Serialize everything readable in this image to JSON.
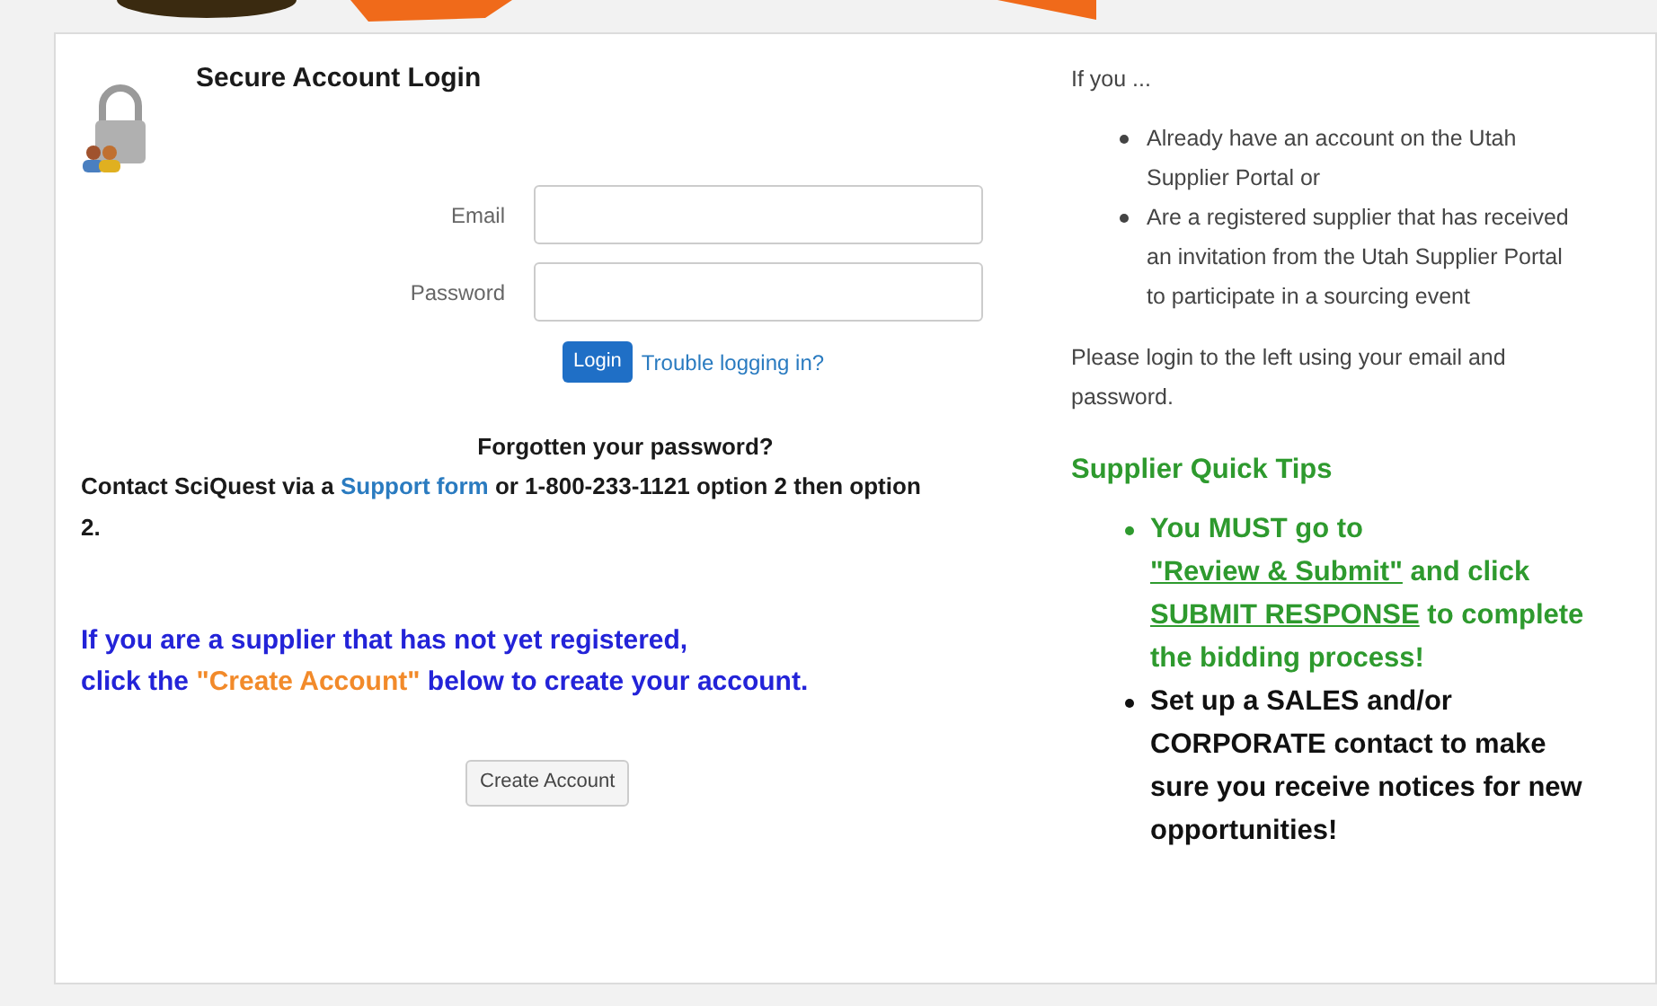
{
  "login": {
    "title": "Secure Account Login",
    "fields": [
      {
        "label": "Email"
      },
      {
        "label": "Password"
      }
    ],
    "submit": "Login",
    "help_link": "Trouble logging in?"
  },
  "forgot": {
    "heading": "Forgotten your password?",
    "message": [
      {
        "kind": "text",
        "text": "Contact SciQuest  via a "
      },
      {
        "kind": "link",
        "text": "Support form"
      },
      {
        "kind": "text",
        "text": " or 1-800-233-1121 option 2 then option 2."
      }
    ]
  },
  "register": {
    "lines": [
      [
        {
          "kind": "text",
          "text": "If you are a supplier that has not yet registered,"
        }
      ],
      [
        {
          "kind": "text",
          "text": "click the "
        },
        {
          "kind": "highlight",
          "text": "\"Create Account\""
        },
        {
          "kind": "text",
          "text": "  below to create your account."
        }
      ]
    ],
    "button": "Create Account"
  },
  "info": {
    "intro": "If you ...",
    "items": [
      "Already have an account on the Utah Supplier Portal or",
      "Are a registered supplier that has received an invitation from the Utah Supplier Portal to participate in a sourcing event"
    ],
    "note": "Please login to the left using your email and password."
  },
  "tips": {
    "title": "Supplier Quick Tips",
    "items": [
      {
        "color": "#2e9a2e",
        "segments": [
          {
            "kind": "text",
            "text": "You MUST go to "
          },
          {
            "kind": "link",
            "text": "\"Review & Submit\""
          },
          {
            "kind": "text",
            "text": " and click "
          },
          {
            "kind": "link",
            "text": "SUBMIT RESPONSE"
          },
          {
            "kind": "text",
            "text": " to complete the bidding process!"
          }
        ]
      },
      {
        "color": "#111111",
        "segments": [
          {
            "kind": "text",
            "text": "Set up a SALES and/or CORPORATE contact to make sure you receive notices for new opportunities!"
          }
        ]
      }
    ]
  }
}
